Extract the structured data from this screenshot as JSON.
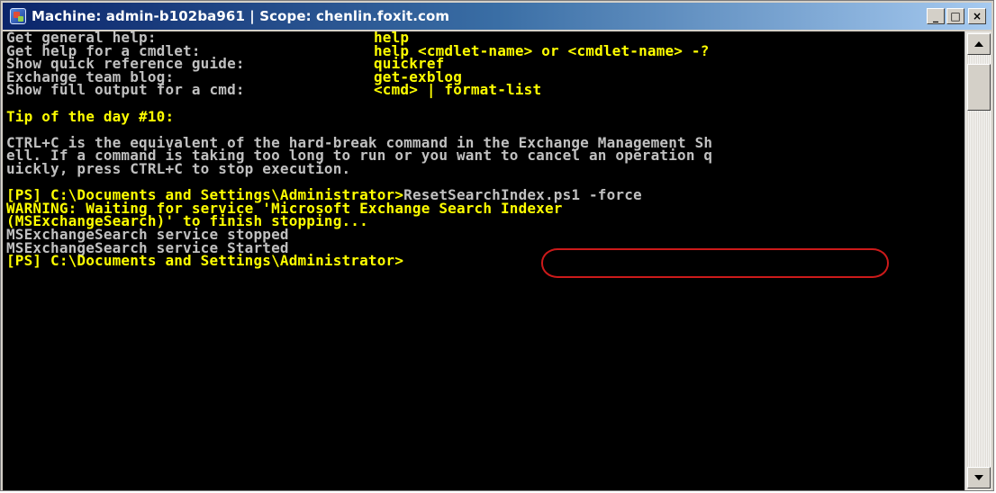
{
  "window": {
    "title": "Machine: admin-b102ba961 | Scope: chenlin.foxit.com",
    "minimize": "_",
    "maximize": "□",
    "close": "×"
  },
  "colors": {
    "console_bg": "#000000",
    "default_text": "#c0c0c0",
    "highlight_text": "#ffff00",
    "annotation_circle": "#cc1a1a"
  },
  "console": {
    "help_rows": [
      {
        "label": "Get general help:",
        "value": "help"
      },
      {
        "label": "Get help for a cmdlet:",
        "value": "help <cmdlet-name> or <cmdlet-name> -?"
      },
      {
        "label": "Show quick reference guide:",
        "value": "quickref"
      },
      {
        "label": "Exchange team blog:",
        "value": "get-exblog"
      },
      {
        "label": "Show full output for a cmd:",
        "value": "<cmd> | format-list"
      }
    ],
    "tip_heading": "Tip of the day #10:",
    "tip_lines": [
      "CTRL+C is the equivalent of the hard-break command in the Exchange Management Sh",
      "ell. If a command is taking too long to run or you want to cancel an operation q",
      "uickly, press CTRL+C to stop execution."
    ],
    "prompt_1": "[PS] C:\\Documents and Settings\\Administrator>",
    "command_1": "ResetSearchIndex.ps1 -force",
    "warning_lines": [
      "WARNING: Waiting for service 'Microsoft Exchange Search Indexer",
      "(MSExchangeSearch)' to finish stopping..."
    ],
    "output_lines": [
      "MSExchangeSearch service stopped",
      "MSExchangeSearch service Started"
    ],
    "prompt_2": "[PS] C:\\Documents and Settings\\Administrator>"
  },
  "scrollbar": {
    "up_icon": "triangle-up",
    "down_icon": "triangle-down"
  }
}
